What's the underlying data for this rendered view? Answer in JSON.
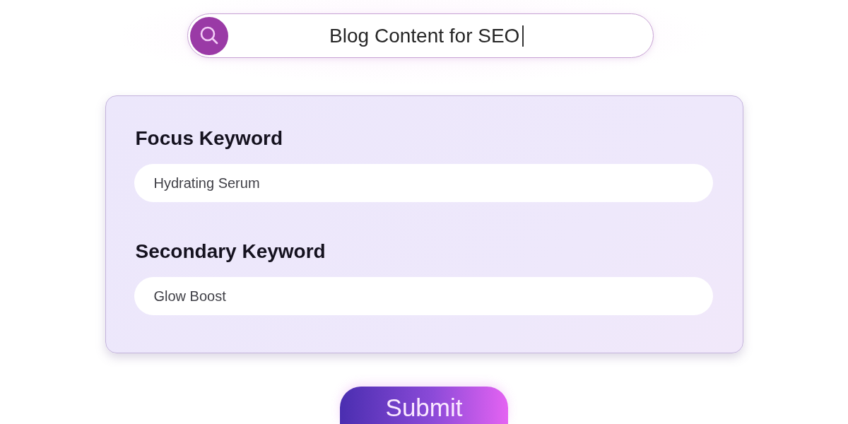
{
  "search": {
    "value": "Blog Content for SEO",
    "focused": true
  },
  "fields": [
    {
      "label": "Focus Keyword",
      "value": "Hydrating Serum"
    },
    {
      "label": "Secondary Keyword",
      "value": "Glow Boost"
    }
  ],
  "submit_button": {
    "label": "Submit"
  }
}
